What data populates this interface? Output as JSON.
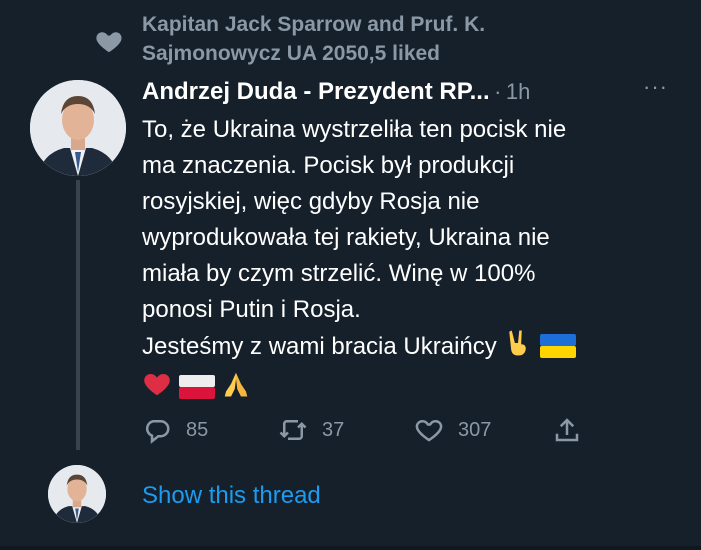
{
  "social_context": {
    "text": "Kapitan Jack Sparrow and Pruf. K. Sajmonowycz UA 2050,5 liked",
    "icon": "heart-icon"
  },
  "tweet": {
    "author_name": "Andrzej Duda - Prezydent RP...",
    "separator": "·",
    "time": "1h",
    "more_icon": "···",
    "text_lines": [
      "To, że Ukraina wystrzeliła ten pocisk nie",
      "ma znaczenia. Pocisk był produkcji",
      "rosyjskiej, więc gdyby Rosja nie",
      "wyprodukowała tej rakiety, Ukraina nie",
      "miała by czym strzelić. Winę w 100%",
      "ponosi Putin i Rosja.",
      "Jesteśmy z wami bracia Ukraińcy"
    ],
    "emojis_line1": [
      "victory-hand",
      "flag-ukraine"
    ],
    "emojis_line2": [
      "red-heart",
      "flag-poland",
      "folded-hands"
    ],
    "actions": {
      "reply_count": "85",
      "retweet_count": "37",
      "like_count": "307"
    }
  },
  "thread": {
    "show_label": "Show this thread"
  },
  "colors": {
    "background": "#15202b",
    "secondary_text": "#8b98a5",
    "link": "#1d9bf0",
    "thread_line": "#38444d"
  }
}
